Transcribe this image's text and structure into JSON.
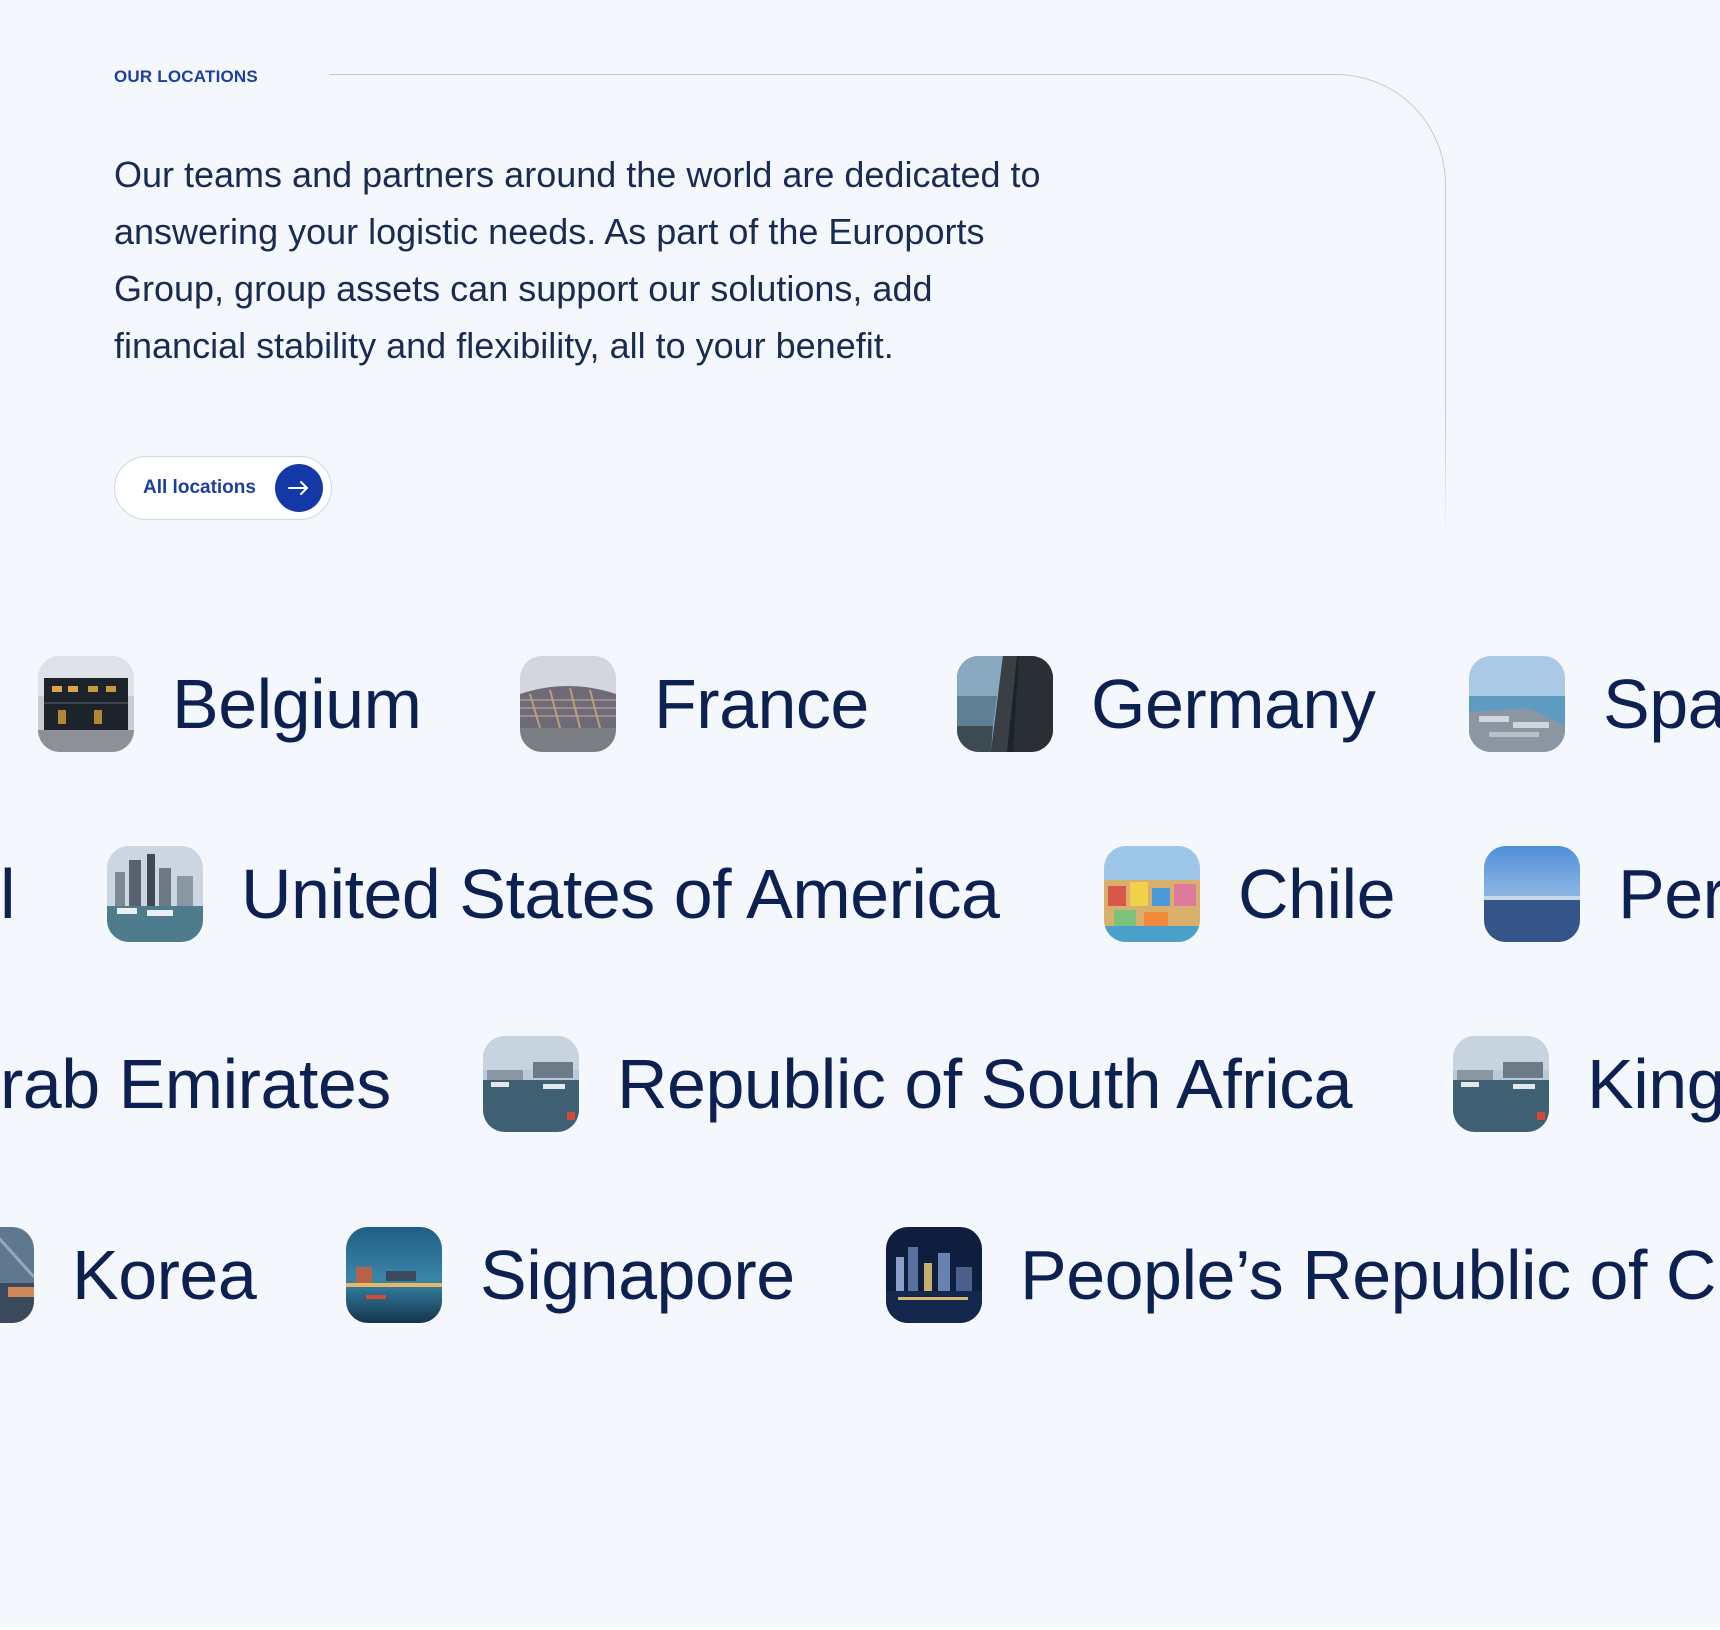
{
  "section": {
    "eyebrow": "OUR LOCATIONS",
    "text": "Our teams and partners around the world are dedicated to answering your logistic needs. As part of the Euroports Group, group assets can support our solutions, add financial stability and flexibility, all to your benefit.",
    "button_label": "All locations",
    "button_icon": "arrow-right-icon"
  },
  "rows": [
    [
      {
        "name": "Belgium",
        "image": "warehouse-photo"
      },
      {
        "name": "France",
        "image": "stadium-photo"
      },
      {
        "name": "Germany",
        "image": "harbor-glass-photo"
      },
      {
        "name": "Spa",
        "image": "port-aerial-photo"
      }
    ],
    [
      {
        "name": "l",
        "image": ""
      },
      {
        "name": "United States of America",
        "image": "marina-skyline-photo"
      },
      {
        "name": "Chile",
        "image": "colorful-city-photo"
      },
      {
        "name": "Per",
        "image": "coast-photo"
      }
    ],
    [
      {
        "name": "rab Emirates",
        "image": ""
      },
      {
        "name": "Republic of South Africa",
        "image": "marina-sunset-photo"
      },
      {
        "name": "King",
        "image": "marina-sunset-photo"
      }
    ],
    [
      {
        "name": "Korea",
        "image": "bridge-photo"
      },
      {
        "name": "Signapore",
        "image": "bay-dusk-photo"
      },
      {
        "name": "People’s Republic of Ch",
        "image": "night-skyline-photo"
      }
    ]
  ]
}
